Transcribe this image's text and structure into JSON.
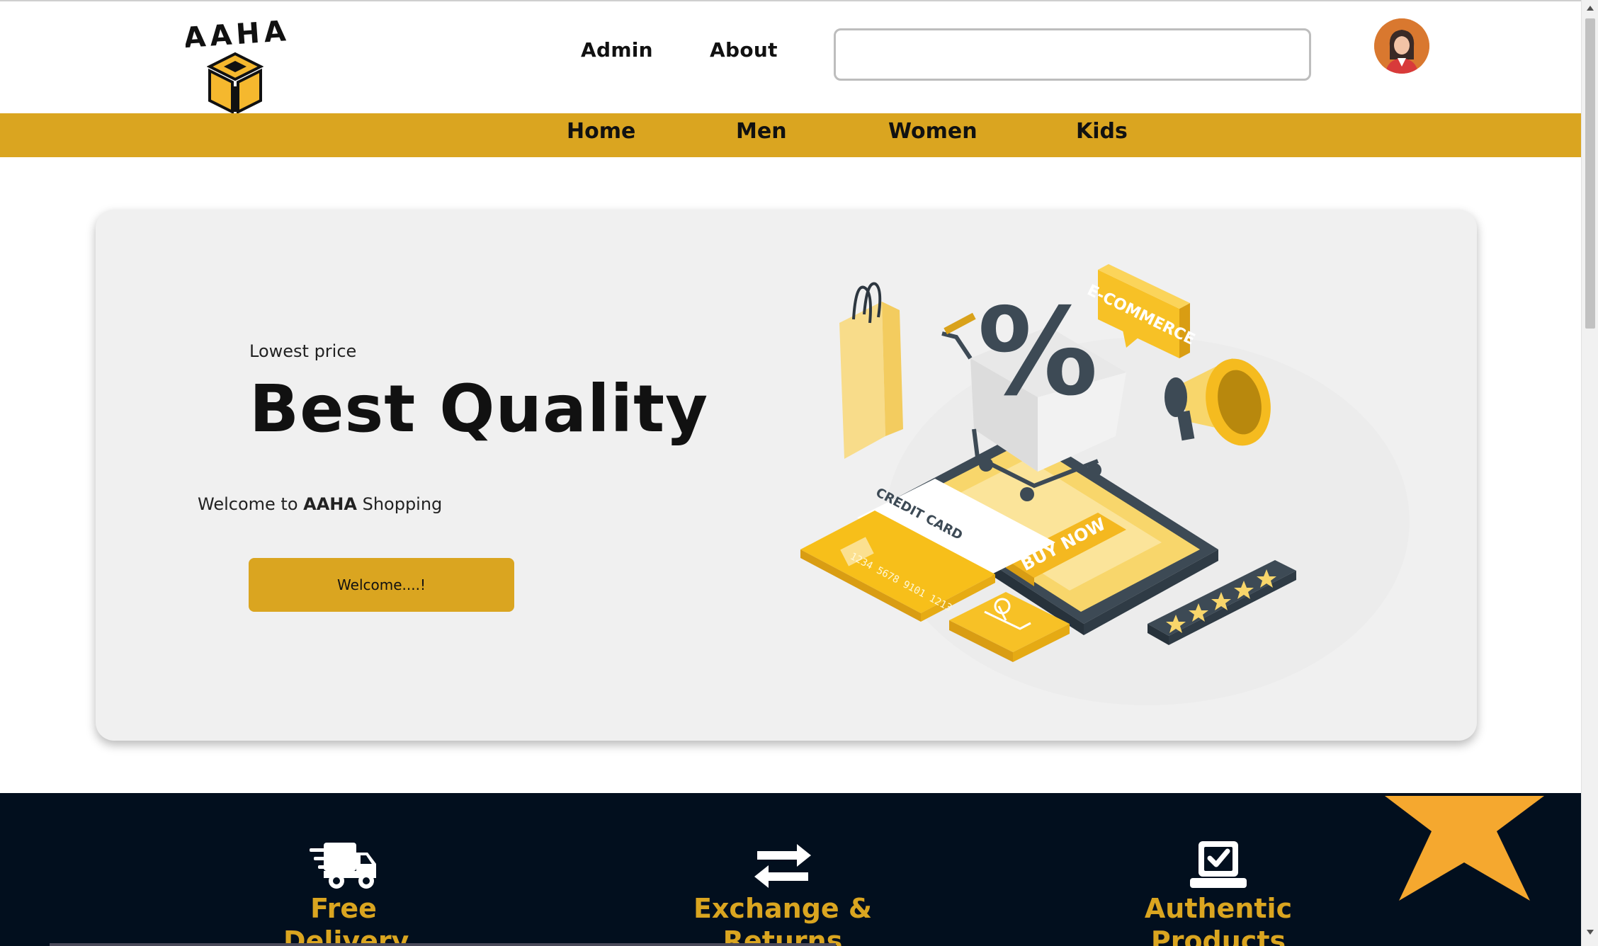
{
  "header": {
    "logo_text": "AAHA",
    "nav": [
      {
        "label": "Admin"
      },
      {
        "label": "About"
      }
    ],
    "search": {
      "placeholder": "",
      "value": ""
    }
  },
  "categories": [
    {
      "label": "Home"
    },
    {
      "label": "Men"
    },
    {
      "label": "Women"
    },
    {
      "label": "Kids"
    }
  ],
  "hero": {
    "kicker": "Lowest price",
    "title": "Best Quality",
    "welcome_prefix": "Welcome to ",
    "welcome_brand": "AAHA",
    "welcome_suffix": " Shopping",
    "button_label": "Welcome....!",
    "illustration": {
      "speech_label": "E-COMMERCE",
      "phone_button": "BUY NOW",
      "card_label": "CREDIT CARD",
      "card_number": "1234  5678  9101  1213",
      "discount_symbol": "%"
    }
  },
  "features": [
    {
      "icon": "truck-icon",
      "label_line1": "Free",
      "label_line2": "Delivery"
    },
    {
      "icon": "exchange-arrows-icon",
      "label_line1": "Exchange &",
      "label_line2": "Returns"
    },
    {
      "icon": "check-box-icon",
      "label_line1": "Authentic",
      "label_line2": "Products"
    }
  ],
  "colors": {
    "accent": "#daa520",
    "dark_band": "#020f1e",
    "hero_bg": "#f0f0f0",
    "star": "#f5a82f"
  }
}
